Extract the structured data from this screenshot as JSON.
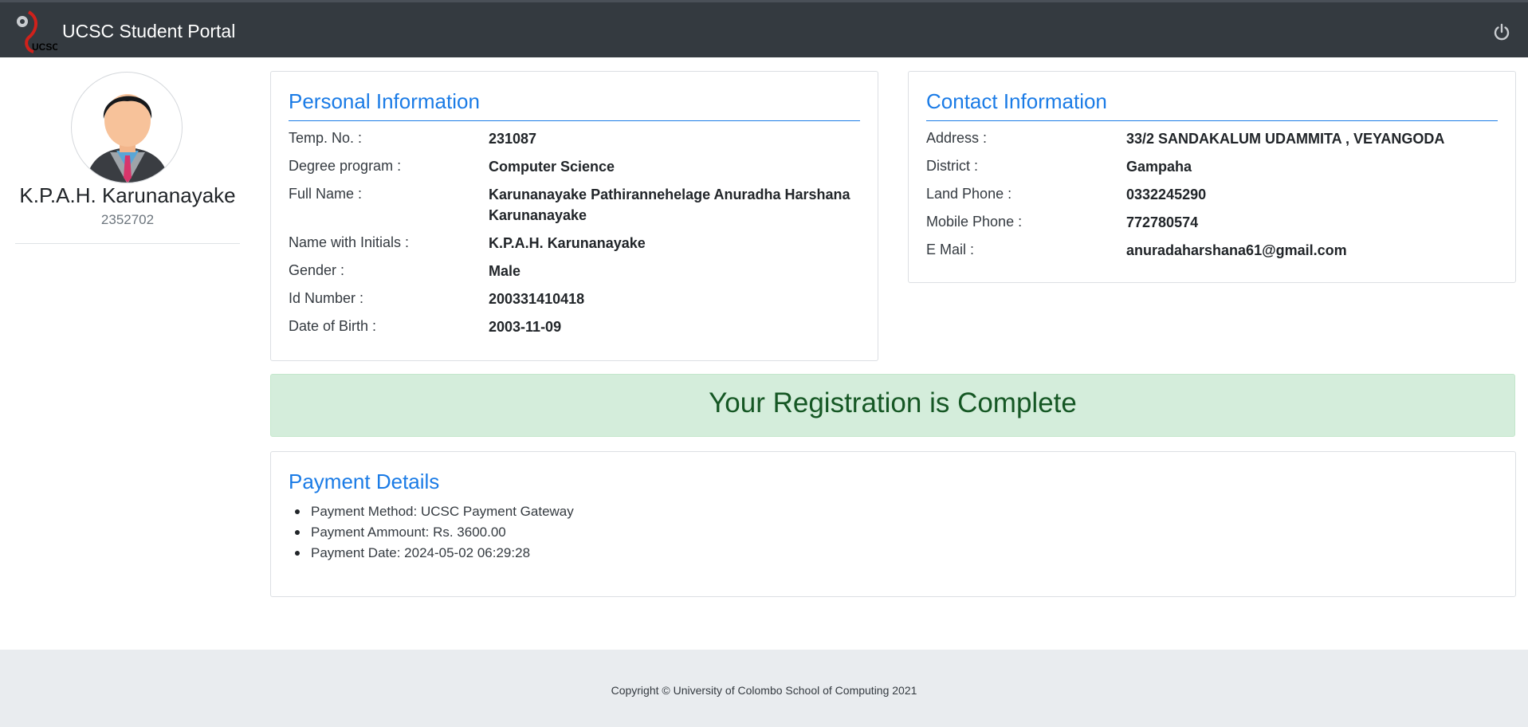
{
  "navbar": {
    "brand": "UCSC Student Portal",
    "logo_icon": "ucsc-logo",
    "logout_icon": "power-icon"
  },
  "profile": {
    "name": "K.P.A.H. Karunanayake",
    "id": "2352702",
    "avatar_icon": "user-avatar"
  },
  "personal": {
    "title": "Personal Information",
    "rows": [
      {
        "label": "Temp. No. :",
        "value": "231087"
      },
      {
        "label": "Degree program :",
        "value": "Computer Science"
      },
      {
        "label": "Full Name :",
        "value": "Karunanayake Pathirannehelage Anuradha Harshana Karunanayake"
      },
      {
        "label": "Name with Initials :",
        "value": "K.P.A.H. Karunanayake"
      },
      {
        "label": "Gender :",
        "value": "Male"
      },
      {
        "label": "Id Number :",
        "value": "200331410418"
      },
      {
        "label": "Date of Birth :",
        "value": "2003-11-09"
      }
    ]
  },
  "contact": {
    "title": "Contact Information",
    "rows": [
      {
        "label": "Address :",
        "value": "33/2 SANDAKALUM UDAMMITA , VEYANGODA"
      },
      {
        "label": "District :",
        "value": "Gampaha"
      },
      {
        "label": "Land Phone :",
        "value": "0332245290"
      },
      {
        "label": "Mobile Phone :",
        "value": "772780574"
      },
      {
        "label": "E Mail :",
        "value": "anuradaharshana61@gmail.com"
      }
    ]
  },
  "registration": {
    "message": "Your Registration is Complete"
  },
  "payment": {
    "title": "Payment Details",
    "items": [
      "Payment Method: UCSC Payment Gateway",
      "Payment Ammount: Rs. 3600.00",
      "Payment Date: 2024-05-02 06:29:28"
    ]
  },
  "footer": {
    "copyright": "Copyright © University of Colombo School of Computing 2021"
  },
  "colors": {
    "navbar": "#343a40",
    "heading_blue": "#1a7be6",
    "success_bg": "#d4eddb",
    "success_text": "#155724",
    "footer_bg": "#e9ecef"
  }
}
